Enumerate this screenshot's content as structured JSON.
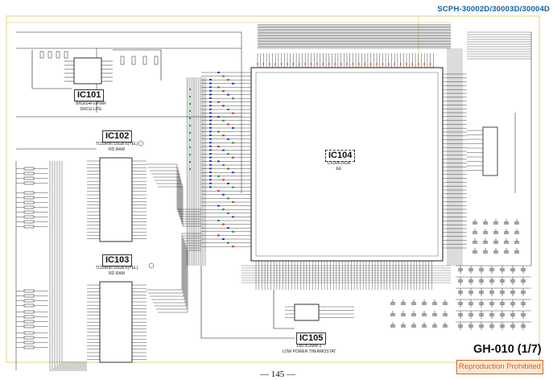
{
  "header": {
    "model_numbers": "SCPH-30002D/30003D/30004D"
  },
  "footer": {
    "board_title": "GH-010 (1/7)",
    "notice": "Reproduction Prohibited",
    "page_number": "— 145 —"
  },
  "components": {
    "ic101": {
      "ref": "IC101",
      "part": "BH3604FV/PWR",
      "desc": "DRCG LITE"
    },
    "ic102": {
      "ref": "IC102",
      "part": "TC59RM716GB-6(YEL)",
      "desc": "RD RAM"
    },
    "ic103": {
      "ref": "IC103",
      "part": "TC59RM716GB-6(YEL)",
      "desc": "RD RAM"
    },
    "ic104": {
      "ref": "IC104",
      "part": "CXD9615GB",
      "desc": "EE"
    },
    "ic105": {
      "ref": "IC105",
      "part": "LM75CIMM-3",
      "desc": "LOW POWER THERMOSTAT"
    }
  },
  "colors": {
    "wire": "#1a1a1a",
    "frame": "#d8c85a",
    "pin_blue": "#2a3fcf",
    "pin_green": "#1e9c3a",
    "pin_red": "#d23a2a",
    "header_blue": "#0f5f9c",
    "notice_bg": "#fbe9d2",
    "notice_text": "#d0602c"
  }
}
